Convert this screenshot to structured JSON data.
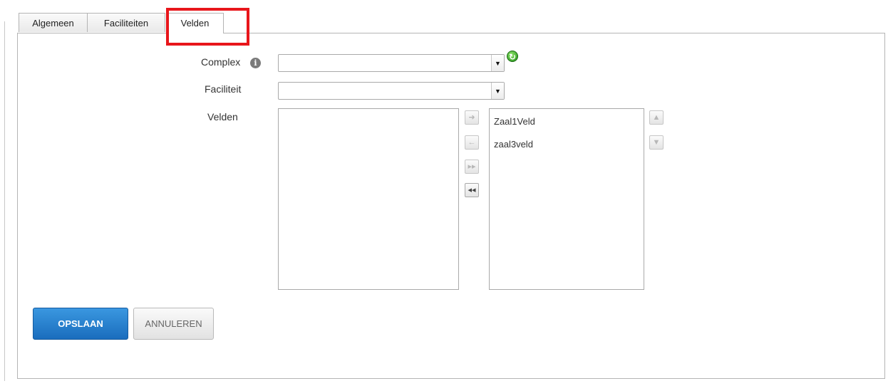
{
  "tabs": [
    {
      "label": "Algemeen",
      "active": false
    },
    {
      "label": "Faciliteiten",
      "active": false
    },
    {
      "label": "Velden",
      "active": true
    }
  ],
  "form": {
    "complex_label": "Complex",
    "complex_value": "",
    "faciliteit_label": "Faciliteit",
    "faciliteit_value": "",
    "velden_label": "Velden"
  },
  "available_items": [],
  "selected_items": [
    "Zaal1Veld",
    "zaal3veld"
  ],
  "icons": {
    "info": "info-icon",
    "refresh": "refresh-icon",
    "dropdown": "chevron-down-icon",
    "move_right": "arrow-right-icon",
    "move_left": "arrow-left-icon",
    "move_all_right": "double-arrow-right-icon",
    "move_all_left": "double-arrow-left-icon",
    "move_up": "arrow-up-icon",
    "move_down": "arrow-down-icon"
  },
  "actions": {
    "save_label": "OPSLAAN",
    "cancel_label": "ANNULEREN"
  },
  "colors": {
    "highlight": "#e8161b",
    "primary": "#1a6dbd",
    "refresh": "#1f8f16"
  }
}
